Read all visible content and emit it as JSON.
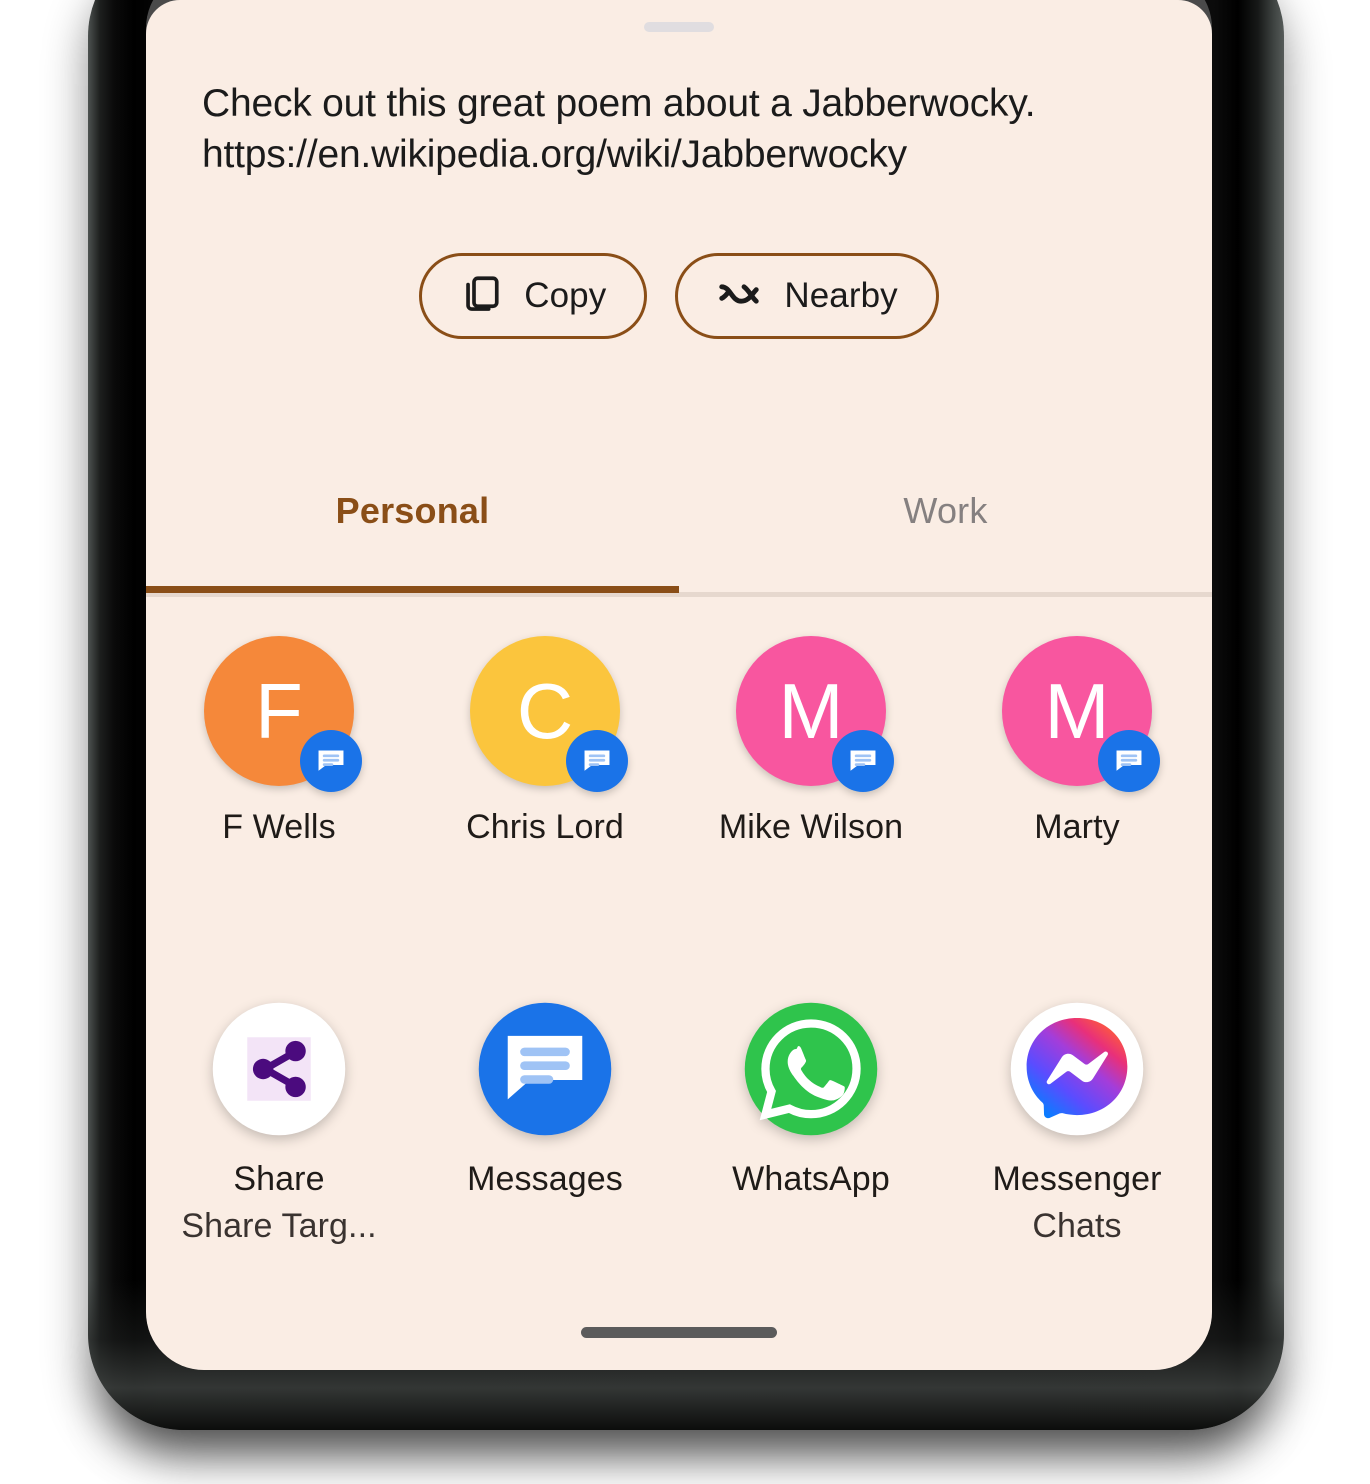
{
  "sheet": {
    "preview_text": "Check out this great poem about a Jabberwocky.\nhttps://en.wikipedia.org/wiki/Jabberwocky",
    "drag_handle": "drag-handle"
  },
  "actions": [
    {
      "label": "Copy",
      "icon": "copy-icon"
    },
    {
      "label": "Nearby",
      "icon": "nearby-share-icon"
    }
  ],
  "tabs": [
    {
      "label": "Personal",
      "active": true
    },
    {
      "label": "Work",
      "active": false
    }
  ],
  "contacts": [
    {
      "name": "F Wells",
      "initial": "F",
      "color": "#F5883A",
      "badge": "messages-icon"
    },
    {
      "name": "Chris Lord",
      "initial": "C",
      "color": "#FBC53D",
      "badge": "messages-icon"
    },
    {
      "name": "Mike Wilson",
      "initial": "M",
      "color": "#F8569F",
      "badge": "messages-icon"
    },
    {
      "name": "Marty",
      "initial": "M",
      "color": "#F8569F",
      "badge": "messages-icon"
    }
  ],
  "apps": [
    {
      "name": "Share",
      "sublabel": "Share Targ...",
      "icon": "share-icon"
    },
    {
      "name": "Messages",
      "sublabel": "",
      "icon": "messages-app-icon"
    },
    {
      "name": "WhatsApp",
      "sublabel": "",
      "icon": "whatsapp-icon"
    },
    {
      "name": "Messenger",
      "sublabel": "Chats",
      "icon": "messenger-icon"
    }
  ],
  "colors": {
    "sheet_background": "#FAEDE4",
    "accent_brown": "#8A4E17",
    "scrim": "#4A4A4A",
    "tab_inactive": "#858080",
    "divider": "#E6D8CE",
    "nav_pill": "#5B5B5B",
    "badge_blue": "#1A73E8"
  }
}
